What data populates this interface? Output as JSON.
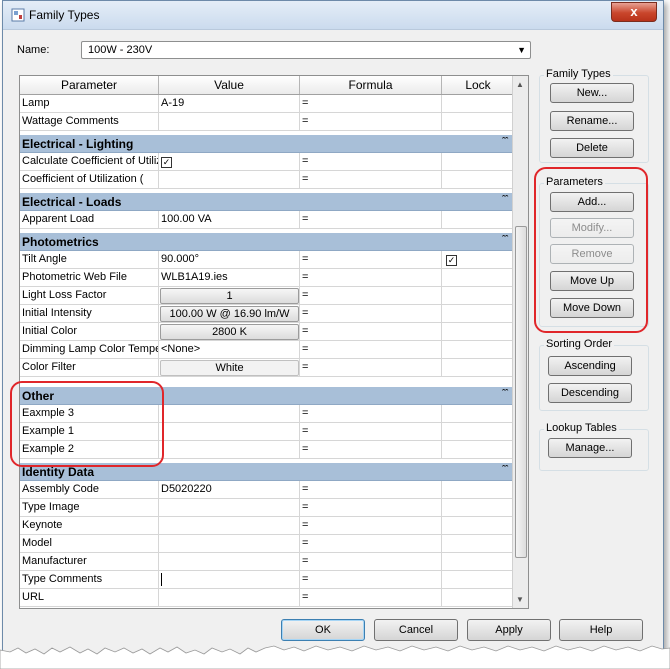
{
  "window": {
    "title": "Family Types",
    "close_glyph": "x"
  },
  "name_label": "Name:",
  "name_value": "100W - 230V",
  "columns": {
    "parameter": "Parameter",
    "value": "Value",
    "formula": "Formula",
    "lock": "Lock"
  },
  "grid": {
    "lamp": {
      "p": "Lamp",
      "v": "A-19",
      "f": "="
    },
    "wattage_comments": {
      "p": "Wattage Comments",
      "v": "",
      "f": "="
    },
    "cat_elec_lighting": "Electrical - Lighting",
    "calc_coef": {
      "p": "Calculate Coefficient of Utilization",
      "f": "="
    },
    "coef_util": {
      "p": "Coefficient of Utilization (",
      "v": "",
      "f": "="
    },
    "cat_elec_loads": "Electrical - Loads",
    "apparent_load": {
      "p": "Apparent Load",
      "v": "100.00 VA",
      "f": "="
    },
    "cat_photometrics": "Photometrics",
    "tilt_angle": {
      "p": "Tilt Angle",
      "v": "90.000°",
      "f": "="
    },
    "photometric_web": {
      "p": "Photometric Web File",
      "v": "WLB1A19.ies",
      "f": "="
    },
    "light_loss": {
      "p": "Light Loss Factor",
      "v": "1",
      "f": "="
    },
    "initial_intensity": {
      "p": "Initial Intensity",
      "v": "100.00 W @ 16.90 lm/W",
      "f": "="
    },
    "initial_color": {
      "p": "Initial Color",
      "v": "2800 K",
      "f": "="
    },
    "dimming": {
      "p": "Dimming Lamp Color Temperature Shift",
      "v": "<None>",
      "f": "="
    },
    "color_filter": {
      "p": "Color Filter",
      "v": "White",
      "f": "="
    },
    "cat_other": "Other",
    "example3": {
      "p": "Eaxmple 3",
      "f": "="
    },
    "example1": {
      "p": "Example 1",
      "f": "="
    },
    "example2": {
      "p": "Example 2",
      "f": "="
    },
    "cat_identity": "Identity Data",
    "assembly_code": {
      "p": "Assembly Code",
      "v": "D5020220",
      "f": "="
    },
    "type_image": {
      "p": "Type Image",
      "f": "="
    },
    "keynote": {
      "p": "Keynote",
      "f": "="
    },
    "model": {
      "p": "Model",
      "f": "="
    },
    "manufacturer": {
      "p": "Manufacturer",
      "f": "="
    },
    "type_comments": {
      "p": "Type Comments",
      "f": "="
    },
    "url": {
      "p": "URL",
      "f": "="
    }
  },
  "family_types": {
    "title": "Family Types",
    "new": "New...",
    "rename": "Rename...",
    "delete": "Delete"
  },
  "parameters": {
    "title": "Parameters",
    "add": "Add...",
    "modify": "Modify...",
    "remove": "Remove",
    "move_up": "Move Up",
    "move_down": "Move Down"
  },
  "sorting": {
    "title": "Sorting Order",
    "ascending": "Ascending",
    "descending": "Descending"
  },
  "lookup": {
    "title": "Lookup Tables",
    "manage": "Manage..."
  },
  "footer": {
    "ok": "OK",
    "cancel": "Cancel",
    "apply": "Apply",
    "help": "Help"
  },
  "colors": {
    "category_band": "#a8bfd8",
    "highlight_red": "#e0262a"
  }
}
